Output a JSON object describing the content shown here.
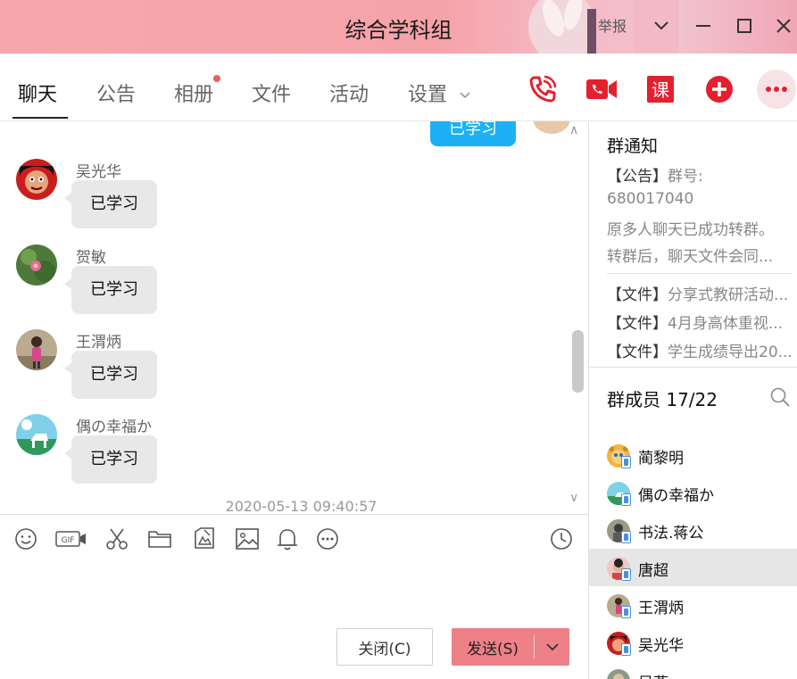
{
  "window": {
    "title": "综合学科组",
    "report": "举报"
  },
  "tabs": [
    {
      "label": "聊天",
      "active": true
    },
    {
      "label": "公告"
    },
    {
      "label": "相册",
      "has_dot": true
    },
    {
      "label": "文件"
    },
    {
      "label": "活动"
    },
    {
      "label": "设置"
    }
  ],
  "toolbar": {
    "course_label": "课",
    "icons": [
      "phone-call-icon",
      "video-call-icon",
      "course-icon",
      "add-icon",
      "more-icon"
    ],
    "accent": "#e5202e"
  },
  "chat": {
    "partial_bubble": "已学习",
    "messages": [
      {
        "sender": "吴光华",
        "text": "已学习"
      },
      {
        "sender": "贺敏",
        "text": "已学习"
      },
      {
        "sender": "王渭炳",
        "text": "已学习"
      },
      {
        "sender": "偶の幸福か",
        "text": "已学习"
      }
    ],
    "timestamp": "2020-05-13 09:40:57",
    "bubble_color": "#e8e8e8",
    "self_bubble_color": "#1eb0f5"
  },
  "input_toolbar": {
    "gif_label": "GIF",
    "icons": [
      "emoji-icon",
      "gif-icon",
      "scissors-icon",
      "folder-icon",
      "picture-edit-icon",
      "image-icon",
      "bell-icon",
      "more-circle-icon",
      "history-icon"
    ]
  },
  "buttons": {
    "close": "关闭(C)",
    "send": "发送(S)",
    "send_color": "#ee8088"
  },
  "notice": {
    "title": "群通知",
    "announcement_tag": "【公告】",
    "announcement_lines": [
      "群号:",
      "680017040",
      "原多人聊天已成功转群。",
      "转群后，聊天文件会同..."
    ],
    "files": [
      {
        "tag": "【文件】",
        "name": "分享式教研活动..."
      },
      {
        "tag": "【文件】",
        "name": "4月身高体重视..."
      },
      {
        "tag": "【文件】",
        "name": "学生成绩导出20..."
      }
    ]
  },
  "members": {
    "title": "群成员 17/22",
    "list": [
      {
        "name": "蔺黎明"
      },
      {
        "name": "偶の幸福か"
      },
      {
        "name": "书法.蒋公"
      },
      {
        "name": "唐超",
        "selected": true
      },
      {
        "name": "王渭炳"
      },
      {
        "name": "吴光华"
      },
      {
        "name": "吴燕"
      }
    ]
  }
}
